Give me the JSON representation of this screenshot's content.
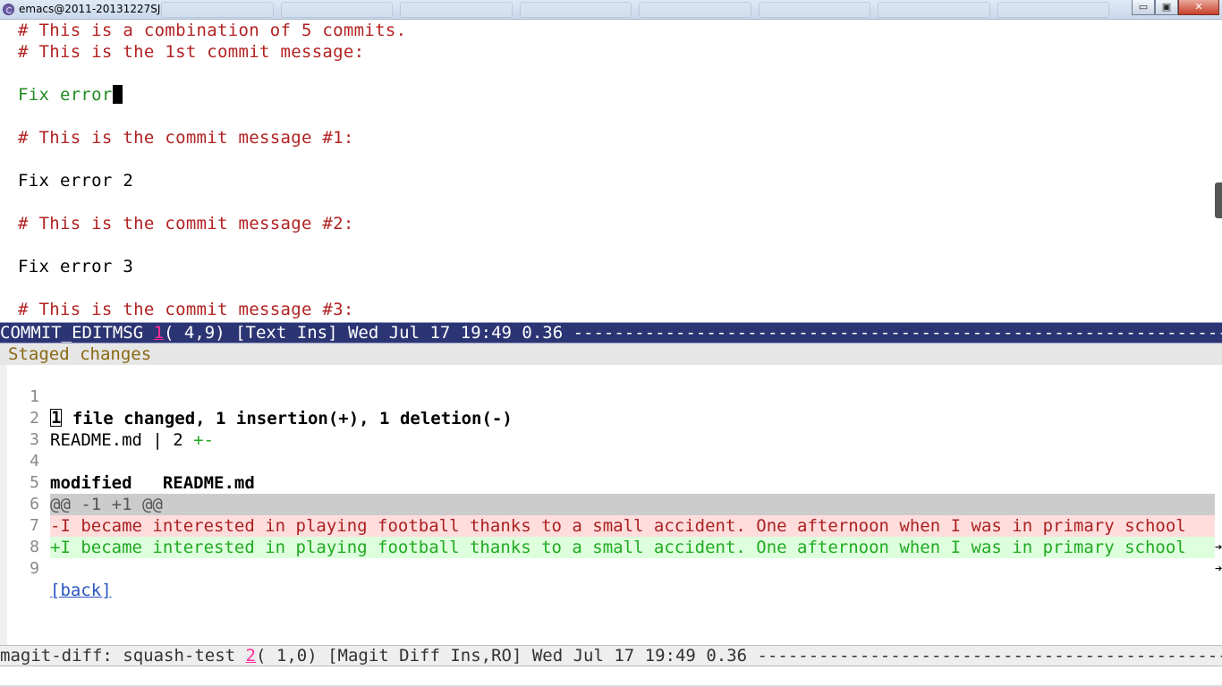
{
  "window": {
    "title": "emacs@2011-20131227SJ",
    "minimize_glyph": "▭",
    "maximize_glyph": "▣",
    "close_glyph": "✕"
  },
  "editor": {
    "lines": [
      "# This is a combination of 5 commits.",
      "# This is the 1st commit message:",
      "",
      "Fix error",
      "",
      "# This is the commit message #1:",
      "",
      "Fix error 2",
      "",
      "# This is the commit message #2:",
      "",
      "Fix error 3",
      "",
      "# This is the commit message #3:"
    ]
  },
  "modeline_top": {
    "buffer_name": "COMMIT_EDITMSG ",
    "window_number": "1",
    "position": "( 4,9) [Text Ins] Wed Jul 17 19:49 0.36 ",
    "fill": "--------------------------------------------------------------------------"
  },
  "magit": {
    "section_heading": "Staged changes",
    "line_numbers": [
      "1",
      "2",
      "3",
      "4",
      "5",
      "6",
      "7",
      "8",
      "9"
    ],
    "stat_first_char": "1",
    "stat_rest": " file changed, 1 insertion(+), 1 deletion(-)",
    "stat_file": "README.md | 2 ",
    "stat_plusminus": "+-",
    "modified_line": "modified   README.md",
    "hunk_header": "@@ -1 +1 @@",
    "removed_line": "-I became interested in playing football thanks to a small accident. One afternoon when I was in primary school",
    "added_line": "+I became interested in playing football thanks to a small accident. One afternoon when I was in primary school",
    "back_link": "[back]",
    "truncation_glyph": "➔"
  },
  "modeline_bottom": {
    "buffer_name": "magit-diff: squash-test ",
    "window_number": "2",
    "position": "( 1,0) [Magit Diff Ins,RO] Wed Jul 17 19:49 0.36 ",
    "fill": "--------------------------------------------------------------------"
  },
  "colors": {
    "comment": "#b22222",
    "summary": "#228b22",
    "modeline_active_bg": "#2c3573",
    "window_number": "#ff2d9b",
    "diff_removed_bg": "#ffdddd",
    "diff_added_bg": "#ddffdd",
    "link": "#2a55c2"
  }
}
